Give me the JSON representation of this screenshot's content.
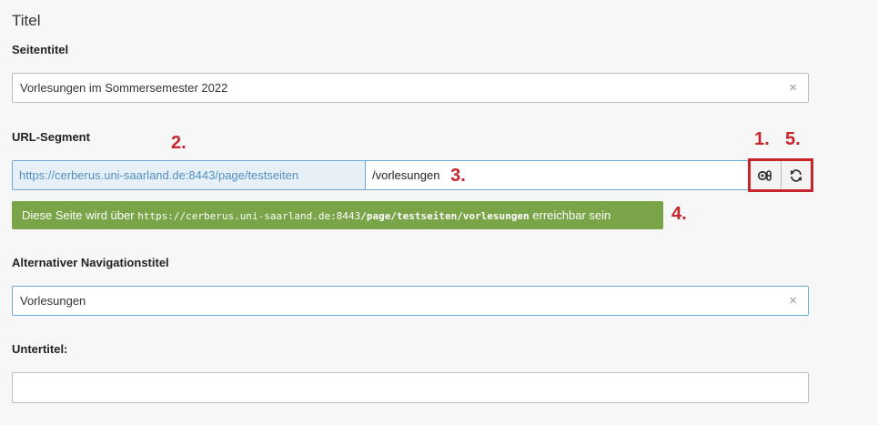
{
  "section": {
    "title": "Titel"
  },
  "page_title": {
    "label": "Seitentitel",
    "value": "Vorlesungen im Sommersemester 2022"
  },
  "url_segment": {
    "label": "URL-Segment",
    "prefix": "https://cerberus.uni-saarland.de:8443/page/testseiten",
    "slug": "/vorlesungen",
    "notice_before": "Diese Seite wird über",
    "notice_url_base": "https://cerberus.uni-saarland.de:8443",
    "notice_url_path": "/page/testseiten/vorlesungen",
    "notice_after": "erreichbar sein"
  },
  "nav_title": {
    "label": "Alternativer Navigationstitel",
    "value": "Vorlesungen"
  },
  "subtitle": {
    "label": "Untertitel:",
    "value": ""
  },
  "markers": [
    "1.",
    "2.",
    "3.",
    "4.",
    "5."
  ],
  "clear_glyph": "×",
  "colors": {
    "accent_blue": "#6aa8d8",
    "prefix_text": "#4f8fc4",
    "notice_green": "#79a548",
    "marker_red": "#c8242c"
  },
  "icons": [
    "toggle-edit-icon",
    "recalculate-icon",
    "clear-icon"
  ]
}
